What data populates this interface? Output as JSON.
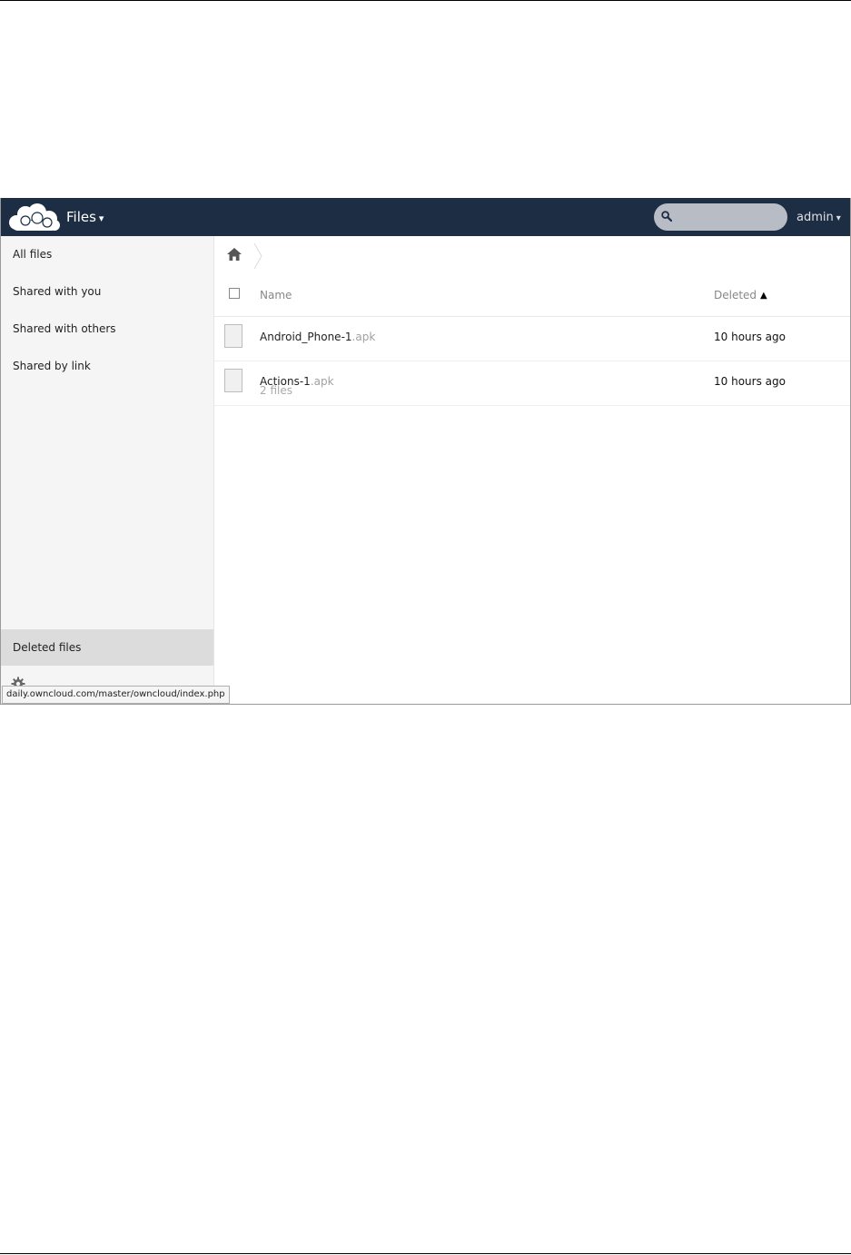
{
  "header": {
    "app_title": "Files",
    "caret": "▾",
    "search_placeholder": "",
    "user": "admin",
    "background_color": "#1d2d44"
  },
  "sidebar": {
    "items": [
      {
        "label": "All files"
      },
      {
        "label": "Shared with you"
      },
      {
        "label": "Shared with others"
      },
      {
        "label": "Shared by link"
      }
    ],
    "deleted_label": "Deleted files"
  },
  "breadcrumb": {
    "home_icon": "home-icon"
  },
  "table": {
    "col_name": "Name",
    "col_deleted": "Deleted",
    "sort_indicator": "▲",
    "rows": [
      {
        "name": "Android_Phone-1",
        "ext": ".apk",
        "deleted": "10 hours ago"
      },
      {
        "name": "Actions-1",
        "ext": ".apk",
        "deleted": "10 hours ago"
      }
    ],
    "summary": "2 files"
  },
  "status_tip": "daily.owncloud.com/master/owncloud/index.php"
}
